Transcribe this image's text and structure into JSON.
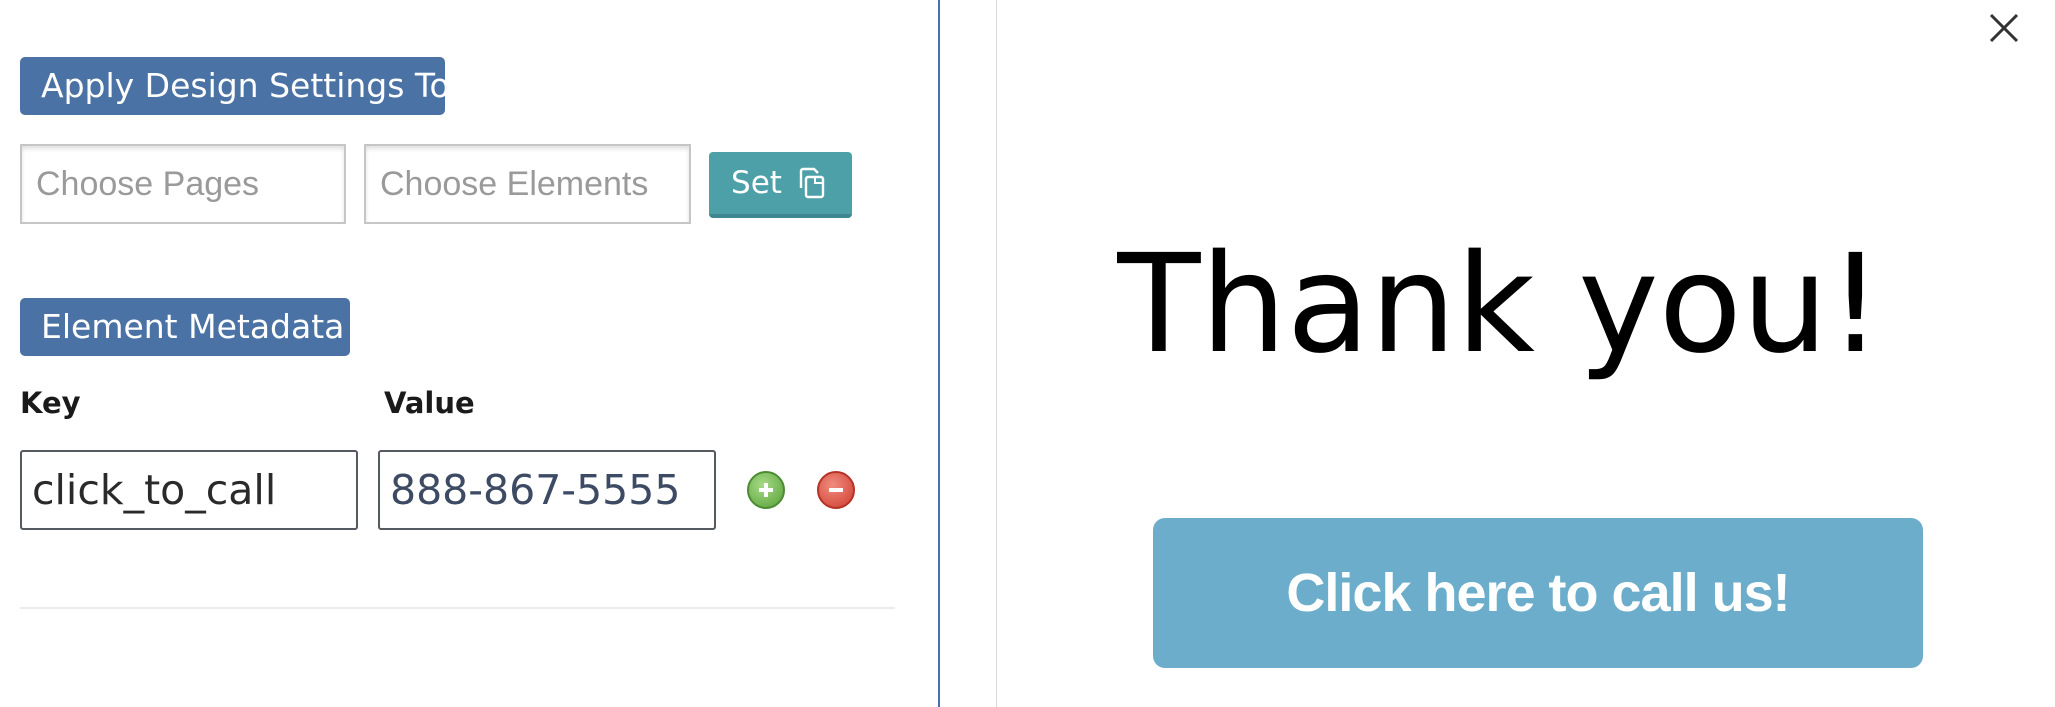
{
  "design_settings": {
    "heading": "Apply Design Settings To",
    "pages_placeholder": "Choose Pages",
    "elements_placeholder": "Choose Elements",
    "set_label": "Set",
    "set_icon": "copy-icon"
  },
  "metadata": {
    "heading": "Element Metadata",
    "key_label": "Key",
    "value_label": "Value",
    "key_value": "click_to_call",
    "value_value": "888-867-5555",
    "add_icon": "plus-circle-icon",
    "remove_icon": "minus-circle-icon"
  },
  "preview": {
    "close_icon": "close-icon",
    "headline": "Thank you!",
    "cta_label": "Click here to call us!"
  },
  "colors": {
    "badge": "#4b72a5",
    "set_button": "#4ea0a8",
    "cta_button": "#6cadcb",
    "add": "#58a13a",
    "remove": "#cf3d30"
  }
}
